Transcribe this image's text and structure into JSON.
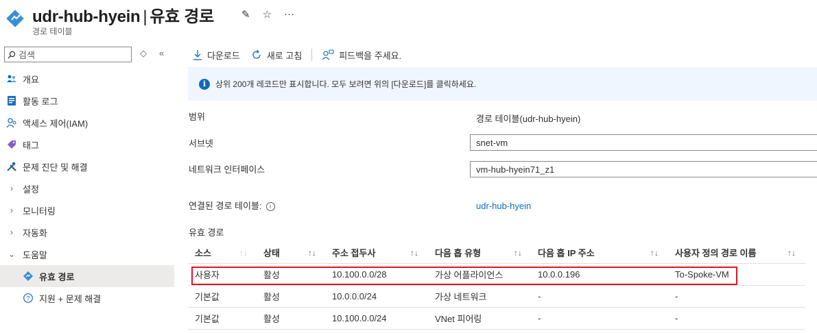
{
  "header": {
    "title": "udr-hub-hyein",
    "separator": "|",
    "page": "유효 경로",
    "subtitle": "경로 테이블",
    "icon": "route-table-diamond-icon"
  },
  "sidebar": {
    "search_placeholder": "검색",
    "items": [
      {
        "label": "개요",
        "icon": "overview-people-icon"
      },
      {
        "label": "활동 로그",
        "icon": "activity-log-icon"
      },
      {
        "label": "액세스 제어(IAM)",
        "icon": "iam-people-icon"
      },
      {
        "label": "태그",
        "icon": "tag-icon"
      },
      {
        "label": "문제 진단 및 해결",
        "icon": "wrench-icon"
      },
      {
        "label": "설정",
        "icon": "chevron-right-icon"
      },
      {
        "label": "모니터링",
        "icon": "chevron-right-icon"
      },
      {
        "label": "자동화",
        "icon": "chevron-right-icon"
      },
      {
        "label": "도움말",
        "icon": "chevron-down-icon"
      },
      {
        "label": "유효 경로",
        "icon": "route-diamond-icon",
        "active": true
      },
      {
        "label": "지원 + 문제 해결",
        "icon": "help-circle-icon"
      }
    ]
  },
  "toolbar": {
    "download": "다운로드",
    "refresh": "새로 고침",
    "feedback": "피드백을 주세요."
  },
  "banner": {
    "text": "상위 200개 레코드만 표시합니다. 모두 보려면 위의 [다운로드]를 클릭하세요."
  },
  "form": {
    "scope_label": "범위",
    "scope_value": "경로 테이블(udr-hub-hyein)",
    "subnet_label": "서브넷",
    "subnet_value": "snet-vm",
    "nic_label": "네트워크 인터페이스",
    "nic_value": "vm-hub-hyein71_z1",
    "linked_label": "연결된 경로 테이블:",
    "linked_value": "udr-hub-hyein",
    "section_title": "유효 경로"
  },
  "table": {
    "columns": [
      "소스",
      "상태",
      "주소 접두사",
      "다음 홉 유형",
      "다음 홉 IP 주소",
      "사용자 정의 경로 이름"
    ],
    "rows": [
      [
        "사용자",
        "활성",
        "10.100.0.0/28",
        "가상 어플라이언스",
        "10.0.0.196",
        "To-Spoke-VM"
      ],
      [
        "기본값",
        "활성",
        "10.0.0.0/24",
        "가상 네트워크",
        "-",
        "-"
      ],
      [
        "기본값",
        "활성",
        "10.100.0.0/24",
        "VNet 피어링",
        "-",
        "-"
      ]
    ]
  },
  "colors": {
    "accent": "#0f6cbd",
    "highlight": "#e81123",
    "banner_bg": "#f0f6ff"
  }
}
